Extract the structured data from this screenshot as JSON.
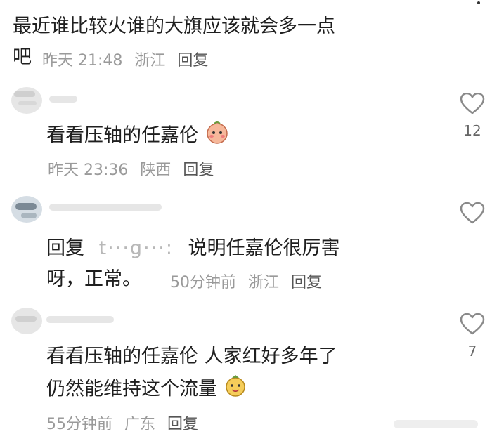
{
  "comments": [
    {
      "text_line1": "最近谁比较火谁的大旗应该就会多一点",
      "text_line2": "吧",
      "time": "昨天 21:48",
      "location": "浙江",
      "reply_label": "回复"
    },
    {
      "text": "看看压轴的任嘉伦",
      "emoji": "blushing-peach-emoji",
      "time": "昨天 23:36",
      "location": "陕西",
      "reply_label": "回复",
      "likes": "12"
    },
    {
      "reply_prefix": "回复",
      "reply_target": "t···g···:",
      "text_line1": "说明任嘉伦很厉害",
      "text_line2": "呀，正常。",
      "time": "50分钟前",
      "location": "浙江",
      "reply_label": "回复"
    },
    {
      "text_line1": "看看压轴的任嘉伦 人家红好多年了",
      "text_line2": "仍然能维持这个流量",
      "emoji": "smiling-dog-emoji",
      "time": "55分钟前",
      "location": "广东",
      "reply_label": "回复",
      "likes": "7"
    }
  ],
  "icons": {
    "like": "heart-outline-icon"
  },
  "colors": {
    "text": "#1f1f1f",
    "meta": "#9a9a9a",
    "icon": "#8a8a8a"
  }
}
